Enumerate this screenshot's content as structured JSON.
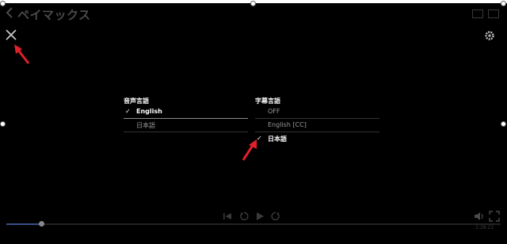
{
  "header": {
    "title": "ペイマックス"
  },
  "audio": {
    "heading": "音声言語",
    "options": [
      {
        "label": "English",
        "selected": true
      },
      {
        "label": "日本語",
        "selected": false
      }
    ]
  },
  "subtitles": {
    "heading": "字幕言語",
    "options": [
      {
        "label": "OFF",
        "selected": false
      },
      {
        "label": "English [CC]",
        "selected": false
      },
      {
        "label": "日本語",
        "selected": true
      }
    ]
  },
  "player": {
    "time": "1:28:22",
    "progress": 0.07
  },
  "colors": {
    "accent": "#e0202a",
    "progress": "#3a4f8a"
  },
  "icons": [
    "back-icon",
    "cast-icon",
    "pip-icon",
    "close-icon",
    "gear-icon",
    "skip-back-icon",
    "rewind-icon",
    "play-icon",
    "forward-icon",
    "volume-icon",
    "fullscreen-icon"
  ]
}
